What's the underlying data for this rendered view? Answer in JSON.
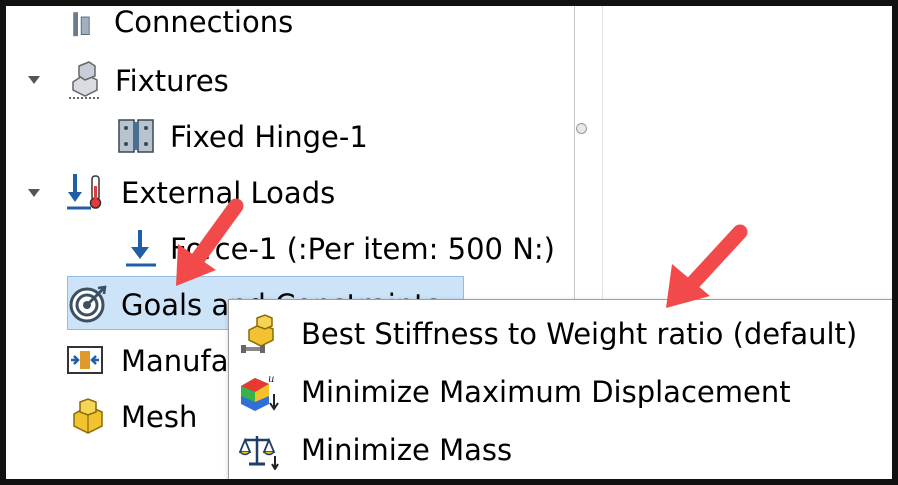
{
  "tree": {
    "items": [
      {
        "label": "Connections",
        "icon": "connections-icon"
      },
      {
        "label": "Fixtures",
        "icon": "fixtures-icon"
      },
      {
        "label": "Fixed Hinge-1",
        "icon": "fixed-hinge-icon"
      },
      {
        "label": "External Loads",
        "icon": "external-loads-icon"
      },
      {
        "label": "Force-1 (:Per item: 500 N:)",
        "icon": "force-icon"
      },
      {
        "label": "Goals and Constraints",
        "icon": "goals-icon"
      },
      {
        "label": "Manufacturing Controls",
        "icon": "manufacturing-icon"
      },
      {
        "label": "Mesh",
        "icon": "mesh-icon"
      }
    ]
  },
  "context_menu": {
    "items": [
      {
        "label": "Best Stiffness to Weight ratio (default)",
        "icon": "stiffness-weight-icon"
      },
      {
        "label": "Minimize Maximum Displacement",
        "icon": "displacement-icon"
      },
      {
        "label": "Minimize Mass",
        "icon": "mass-scale-icon"
      }
    ]
  },
  "colors": {
    "selection_bg": "#cde3f7",
    "annotation_arrow": "#f24a4a",
    "load_blue": "#1f5fa6"
  }
}
